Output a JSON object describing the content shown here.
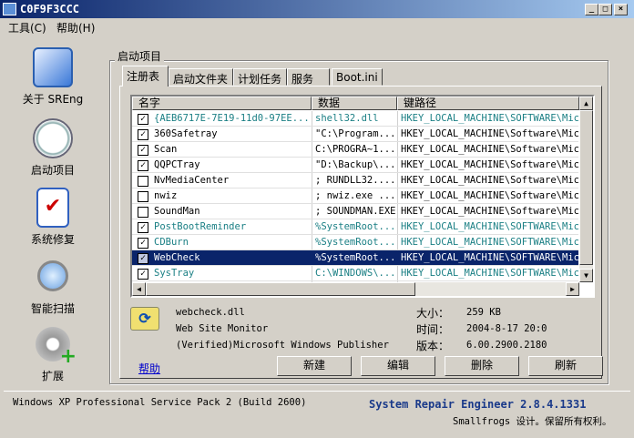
{
  "window": {
    "title": "C0F9F3CCC",
    "minimize": "_",
    "maximize": "□",
    "close": "×"
  },
  "menu": [
    {
      "label": "工具(C)"
    },
    {
      "label": "帮助(H)"
    }
  ],
  "sidebar": [
    {
      "label": "关于 SREng"
    },
    {
      "label": "启动项目"
    },
    {
      "label": "系统修复"
    },
    {
      "label": "智能扫描"
    },
    {
      "label": "扩展"
    }
  ],
  "group_title": "启动项目",
  "tabs": [
    {
      "label": "注册表"
    },
    {
      "label": "启动文件夹"
    },
    {
      "label": "计划任务"
    },
    {
      "label": "服务"
    },
    {
      "label": "Boot.ini"
    }
  ],
  "columns": [
    "名字",
    "数据",
    "键路径"
  ],
  "rows": [
    {
      "checked": true,
      "name": "{AEB6717E-7E19-11d0-97EE...",
      "data": "shell32.dll",
      "path": "HKEY_LOCAL_MACHINE\\SOFTWARE\\Micr",
      "style": "teal"
    },
    {
      "checked": true,
      "name": "360Safetray",
      "data": "\"C:\\Program...",
      "path": "HKEY_LOCAL_MACHINE\\Software\\Micr",
      "style": ""
    },
    {
      "checked": true,
      "name": "Scan",
      "data": "C:\\PROGRA~1...",
      "path": "HKEY_LOCAL_MACHINE\\Software\\Micr",
      "style": ""
    },
    {
      "checked": true,
      "name": " QQPCTray",
      "data": "\"D:\\Backup\\...",
      "path": "HKEY_LOCAL_MACHINE\\Software\\Micr",
      "style": ""
    },
    {
      "checked": false,
      "name": "NvMediaCenter",
      "data": "; RUNDLL32....",
      "path": "HKEY_LOCAL_MACHINE\\Software\\Micr",
      "style": ""
    },
    {
      "checked": false,
      "name": "nwiz",
      "data": "; nwiz.exe ...",
      "path": "HKEY_LOCAL_MACHINE\\Software\\Micr",
      "style": ""
    },
    {
      "checked": false,
      "name": "SoundMan",
      "data": "; SOUNDMAN.EXE",
      "path": "HKEY_LOCAL_MACHINE\\Software\\Micr",
      "style": ""
    },
    {
      "checked": true,
      "name": "PostBootReminder",
      "data": "%SystemRoot...",
      "path": "HKEY_LOCAL_MACHINE\\SOFTWARE\\Micr",
      "style": "teal"
    },
    {
      "checked": true,
      "name": "CDBurn",
      "data": "%SystemRoot...",
      "path": "HKEY_LOCAL_MACHINE\\SOFTWARE\\Micr",
      "style": "teal"
    },
    {
      "checked": true,
      "name": "WebCheck",
      "data": "%SystemRoot...",
      "path": "HKEY_LOCAL_MACHINE\\SOFTWARE\\Micr",
      "style": "sel"
    },
    {
      "checked": true,
      "name": "SysTray",
      "data": "C:\\WINDOWS\\...",
      "path": "HKEY_LOCAL_MACHINE\\SOFTWARE\\Micr",
      "style": "teal"
    }
  ],
  "details": {
    "file": "webcheck.dll",
    "description": "Web Site Monitor",
    "publisher": "(Verified)Microsoft Windows Publisher",
    "size_label": "大小：",
    "size": "259 KB",
    "time_label": "时间：",
    "time": "2004-8-17 20:0",
    "version_label": "版本：",
    "version": "6.00.2900.2180"
  },
  "help_link": "帮助",
  "buttons": {
    "new": "新建",
    "edit": "编辑",
    "delete": "删除",
    "refresh": "刷新"
  },
  "status": {
    "os": "Windows XP Professional Service Pack 2 (Build 2600)",
    "product": "System Repair Engineer 2.8.4.1331",
    "copyright": "Smallfrogs 设计。保留所有权利。"
  }
}
